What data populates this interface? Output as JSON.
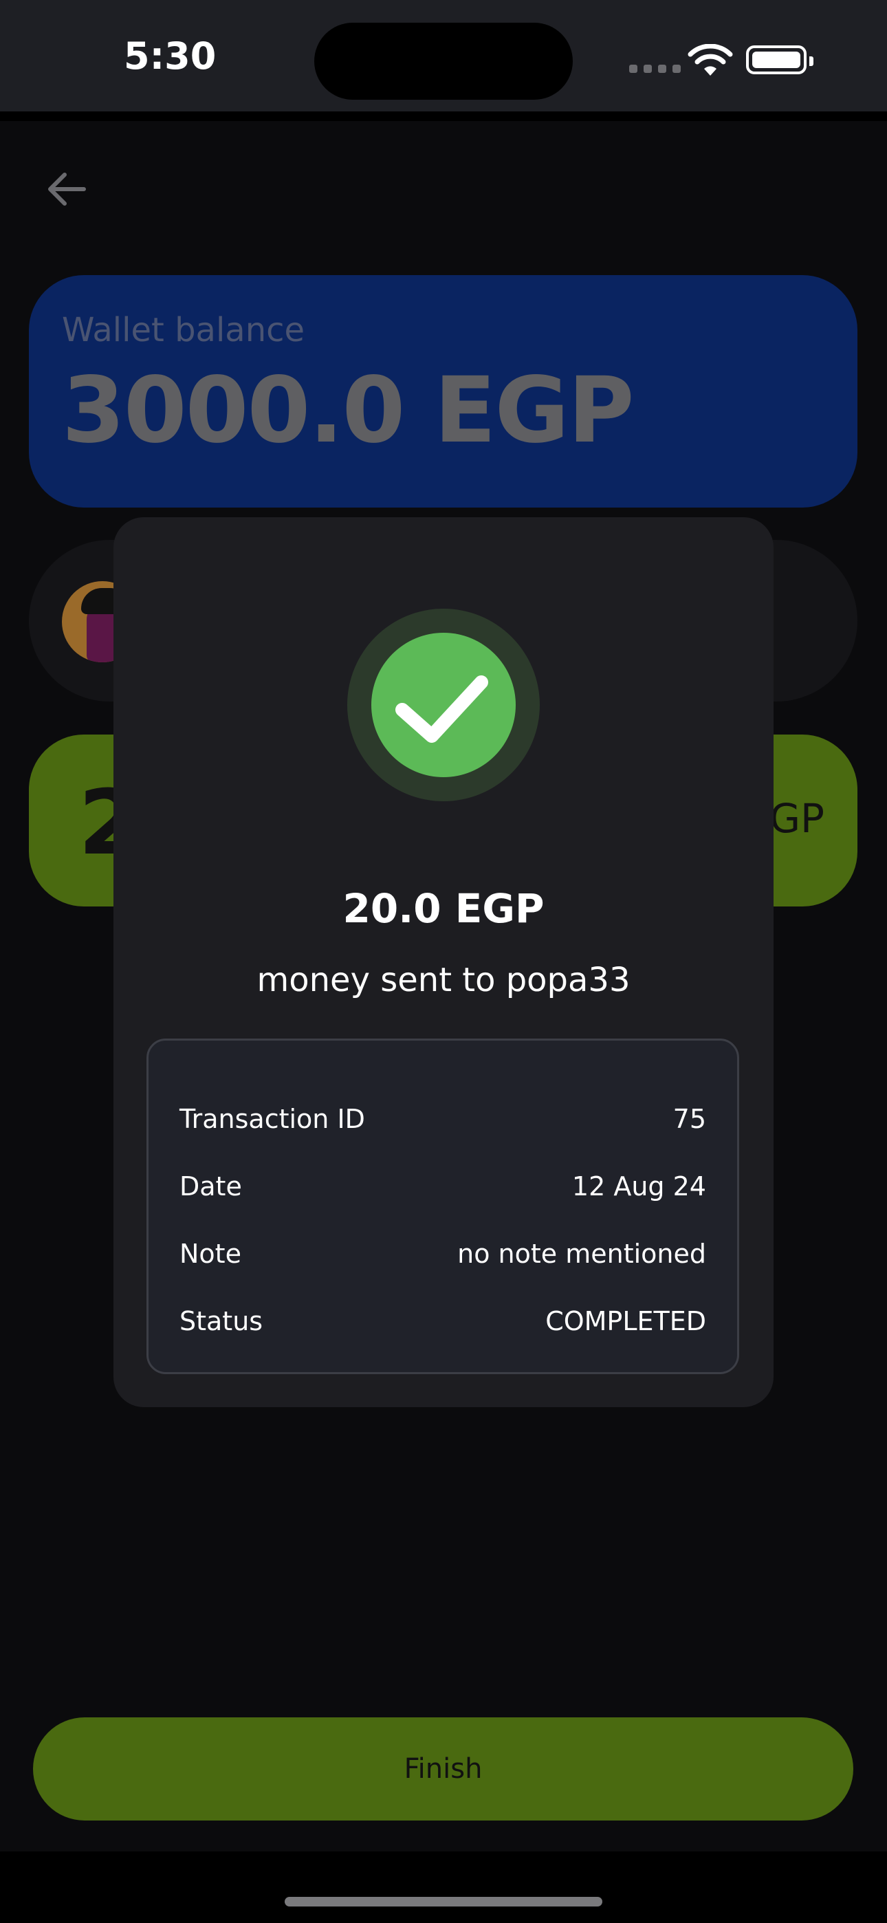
{
  "status_bar": {
    "time": "5:30"
  },
  "wallet": {
    "label": "Wallet balance",
    "balance": "3000.0 EGP"
  },
  "background_amount": {
    "left_partial": "2",
    "right_partial": "GP"
  },
  "modal": {
    "amount": "20.0 EGP",
    "message": "money sent to popa33",
    "details": [
      {
        "label": "Transaction ID",
        "value": "75"
      },
      {
        "label": "Date",
        "value": "12 Aug 24"
      },
      {
        "label": "Note",
        "value": "no note mentioned"
      },
      {
        "label": "Status",
        "value": "COMPLETED"
      }
    ]
  },
  "footer": {
    "finish_label": "Finish"
  },
  "icons": {
    "back": "arrow-left-icon",
    "success": "check-icon",
    "wifi": "wifi-icon",
    "battery": "battery-icon",
    "signal": "signal-icon"
  },
  "colors": {
    "background": "#0b0b0d",
    "wallet_card": "#0a2461",
    "accent_green": "#4a6a10",
    "success_green": "#5cba57",
    "modal_bg": "#1d1d21"
  }
}
